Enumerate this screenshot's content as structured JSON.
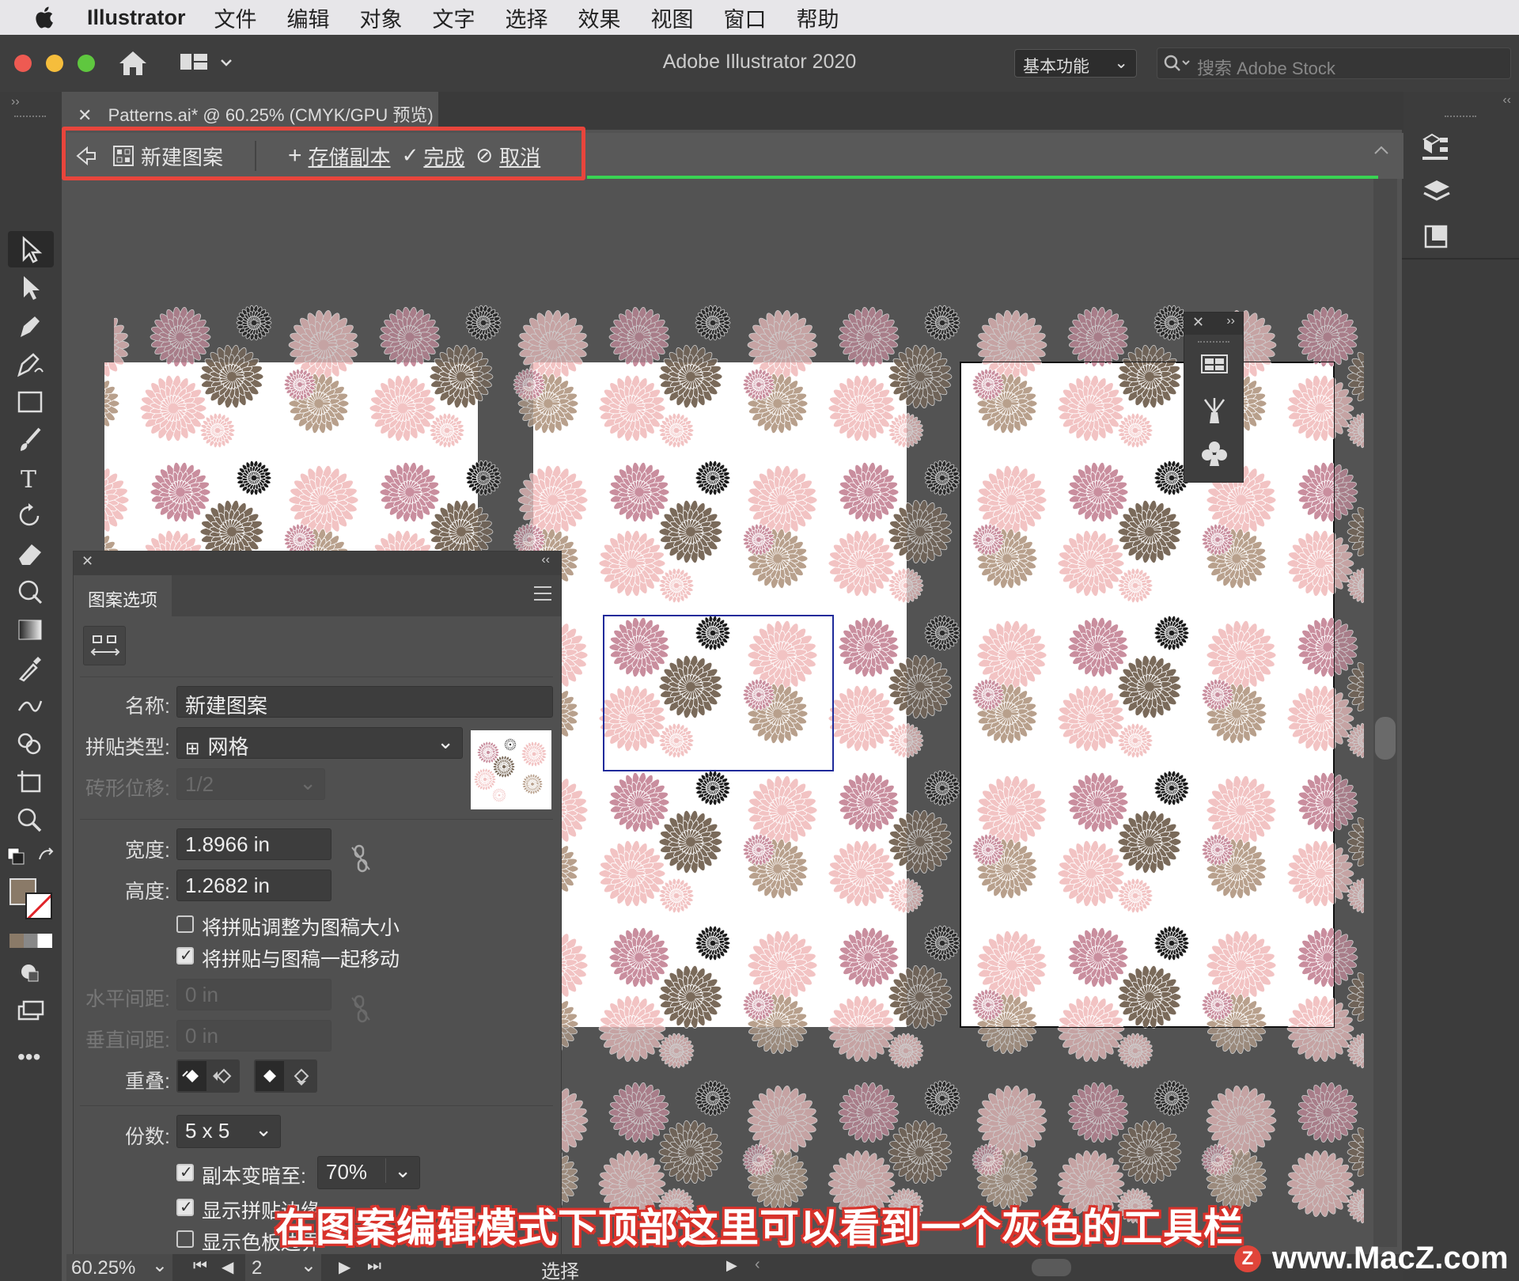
{
  "menubar": {
    "app": "Illustrator",
    "items": [
      "文件",
      "编辑",
      "对象",
      "文字",
      "选择",
      "效果",
      "视图",
      "窗口",
      "帮助"
    ]
  },
  "window": {
    "title": "Adobe Illustrator 2020",
    "workspace": "基本功能",
    "stock_placeholder": "搜索 Adobe Stock"
  },
  "document_tab": {
    "label": "Patterns.ai* @ 60.25% (CMYK/GPU 预览)"
  },
  "pattern_bar": {
    "name": "新建图案",
    "save_copy": "存储副本",
    "done": "完成",
    "cancel": "取消"
  },
  "pattern_panel": {
    "tab": "图案选项",
    "name_label": "名称:",
    "name_value": "新建图案",
    "tile_type_label": "拼贴类型:",
    "tile_type_value": "网格",
    "brick_offset_label": "砖形位移:",
    "brick_offset_value": "1/2",
    "width_label": "宽度:",
    "width_value": "1.8966 in",
    "height_label": "高度:",
    "height_value": "1.2682 in",
    "size_tile_to_art": "将拼贴调整为图稿大小",
    "move_tile_with_art": "将拼贴与图稿一起移动",
    "h_spacing_label": "水平间距:",
    "h_spacing_value": "0 in",
    "v_spacing_label": "垂直间距:",
    "v_spacing_value": "0 in",
    "overlap_label": "重叠:",
    "copies_label": "份数:",
    "copies_value": "5 x 5",
    "dim_copies_label": "副本变暗至:",
    "dim_copies_value": "70%",
    "show_tile_edge": "显示拼贴边缘",
    "show_swatch_bounds": "显示色板边界",
    "checkboxes": {
      "size_tile_to_art": false,
      "move_tile_with_art": true,
      "dim_copies": true,
      "show_tile_edge": true,
      "show_swatch_bounds": false
    }
  },
  "statusbar": {
    "zoom": "60.25%",
    "artboard": "2",
    "tool": "选择"
  },
  "caption": "在图案编辑模式下顶部这里可以看到一个灰色的工具栏",
  "watermark": "www.MacZ.com",
  "colors": {
    "highlight_outline": "#e8453c",
    "accent_green": "#39d353",
    "flower_pink": "#f2c3c3",
    "flower_rose": "#c98e9e",
    "flower_brown": "#7a6a5a",
    "flower_tan": "#b8a08c",
    "flower_dark": "#555555"
  }
}
